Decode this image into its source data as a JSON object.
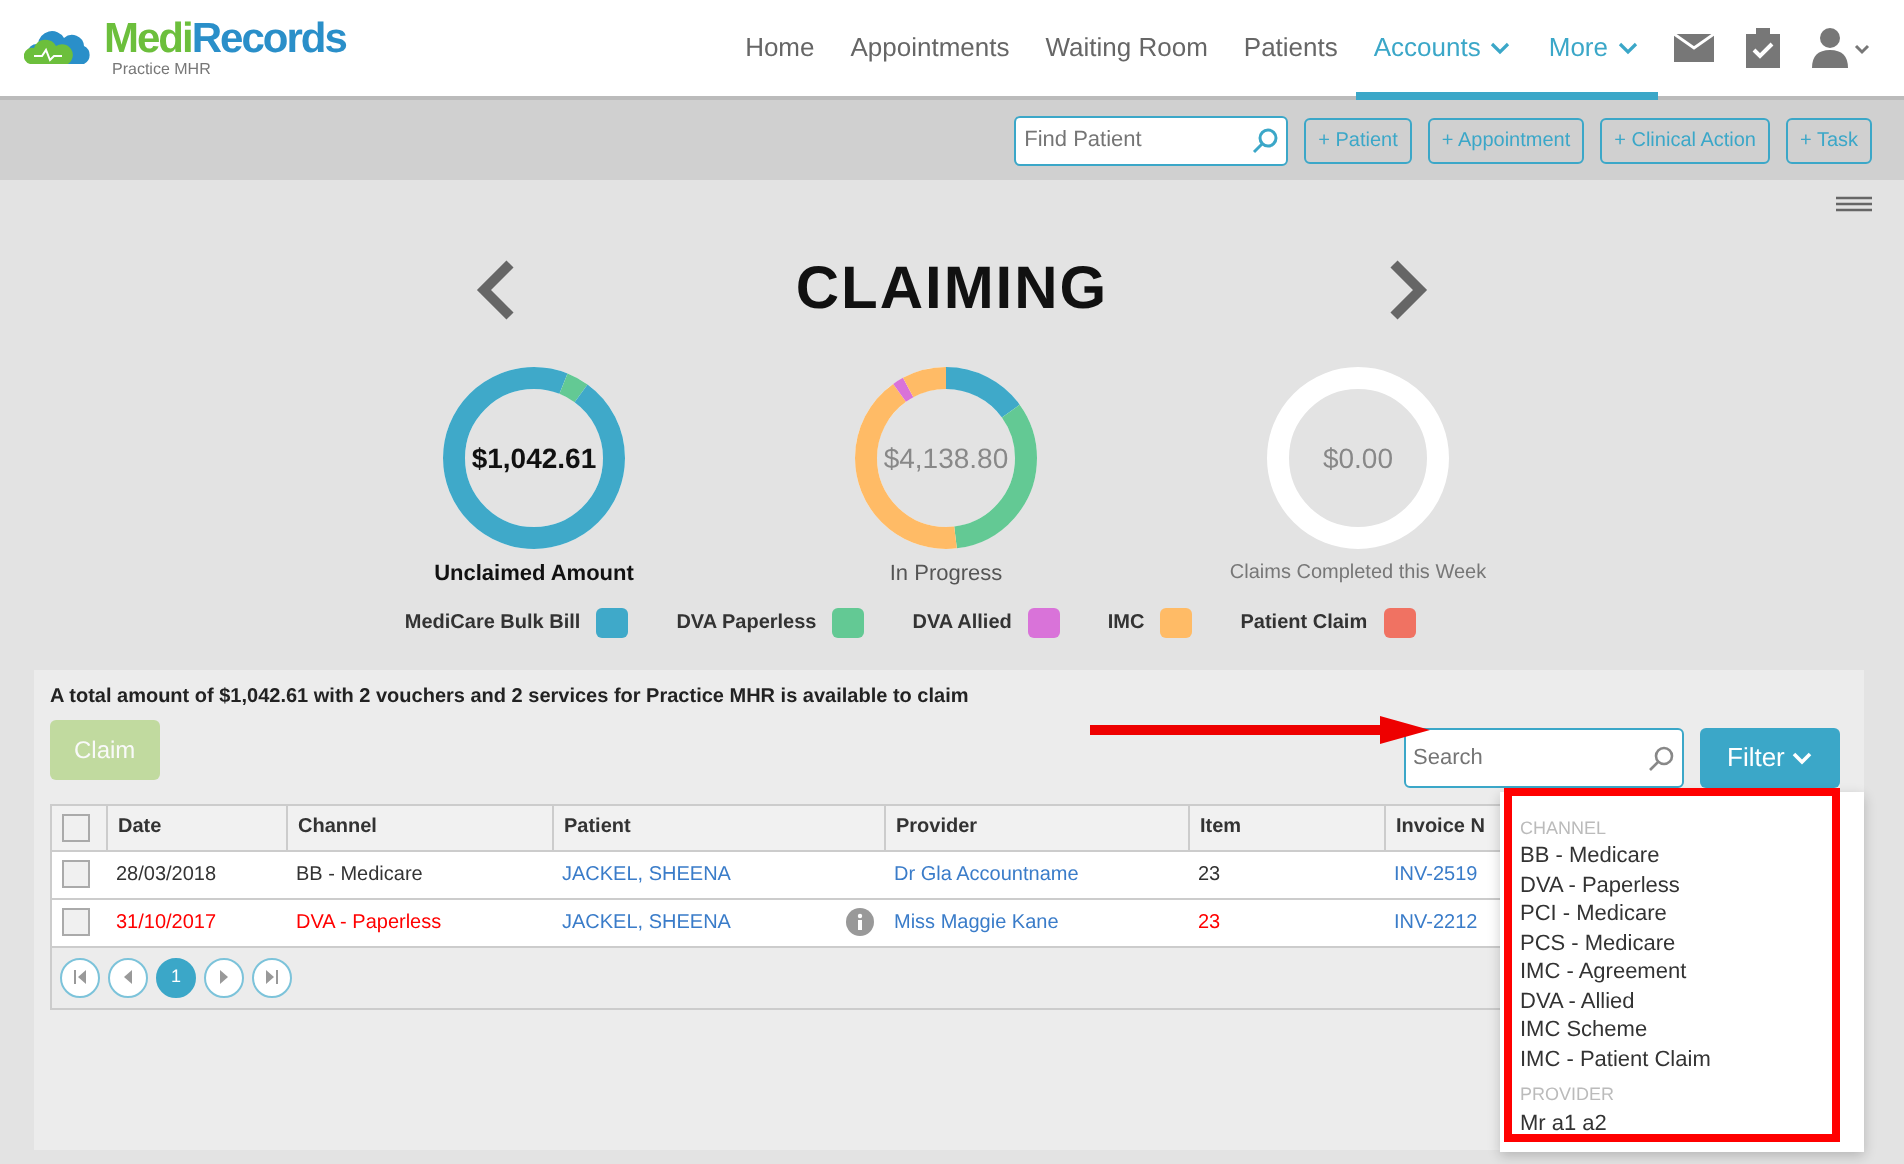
{
  "logo": {
    "name_a": "Medi",
    "name_b": "Records",
    "subtitle": "Practice MHR"
  },
  "nav": [
    {
      "label": "Home",
      "selected": false,
      "dropdown": false
    },
    {
      "label": "Appointments",
      "selected": false,
      "dropdown": false
    },
    {
      "label": "Waiting Room",
      "selected": false,
      "dropdown": false
    },
    {
      "label": "Patients",
      "selected": false,
      "dropdown": false
    },
    {
      "label": "Accounts",
      "selected": true,
      "dropdown": true
    },
    {
      "label": "More",
      "selected": true,
      "dropdown": true
    }
  ],
  "toolbar": {
    "search": {
      "placeholder": "Find Patient"
    },
    "buttons": [
      "+ Patient",
      "+ Appointment",
      "+ Clinical Action",
      "+ Task"
    ]
  },
  "page": {
    "title": "CLAIMING"
  },
  "summaries": [
    {
      "amount": "$1,042.61",
      "label": "Unclaimed Amount",
      "emphasis": true
    },
    {
      "amount": "$4,138.80",
      "label": "In Progress",
      "emphasis": false
    },
    {
      "amount": "$0.00",
      "label": "Claims Completed this Week",
      "emphasis": false
    }
  ],
  "legend": [
    {
      "label": "MediCare Bulk Bill",
      "color": "#3fa9c9"
    },
    {
      "label": "DVA Paperless",
      "color": "#63c994"
    },
    {
      "label": "DVA Allied",
      "color": "#d973d9"
    },
    {
      "label": "IMC",
      "color": "#ffbb66"
    },
    {
      "label": "Patient Claim",
      "color": "#f07262"
    }
  ],
  "claim_panel": {
    "summary": "A total amount of $1,042.61 with 2 vouchers and 2 services for Practice MHR is available to claim",
    "claim_button": {
      "label": "Claim",
      "disabled": true
    },
    "search": {
      "placeholder": "Search"
    },
    "filter_button": "Filter",
    "table": {
      "all_selected": false,
      "columns": [
        "Date",
        "Channel",
        "Patient",
        "Provider",
        "Item",
        "Invoice N"
      ],
      "rows": [
        {
          "cells": [
            "28/03/2018",
            "BB - Medicare",
            "JACKEL, SHEENA",
            "Dr Gla Accountname",
            "23",
            "INV-2519"
          ],
          "flagged": false,
          "info": false,
          "checked": false
        },
        {
          "cells": [
            "31/10/2017",
            "DVA - Paperless",
            "JACKEL, SHEENA",
            "Miss Maggie Kane",
            "23",
            "INV-2212"
          ],
          "flagged": true,
          "info": true,
          "checked": false
        }
      ]
    },
    "pagination": {
      "pages": [
        {
          "label": "1",
          "selected": true
        }
      ]
    }
  },
  "filter_menu": {
    "sections": [
      {
        "heading": "CHANNEL",
        "items": [
          "BB - Medicare",
          "DVA - Paperless",
          "PCI - Medicare",
          "PCS - Medicare",
          "IMC - Agreement",
          "DVA - Allied",
          "IMC Scheme",
          "IMC - Patient Claim"
        ]
      },
      {
        "heading": "PROVIDER",
        "items": [
          "Mr a1 a2"
        ]
      }
    ]
  }
}
